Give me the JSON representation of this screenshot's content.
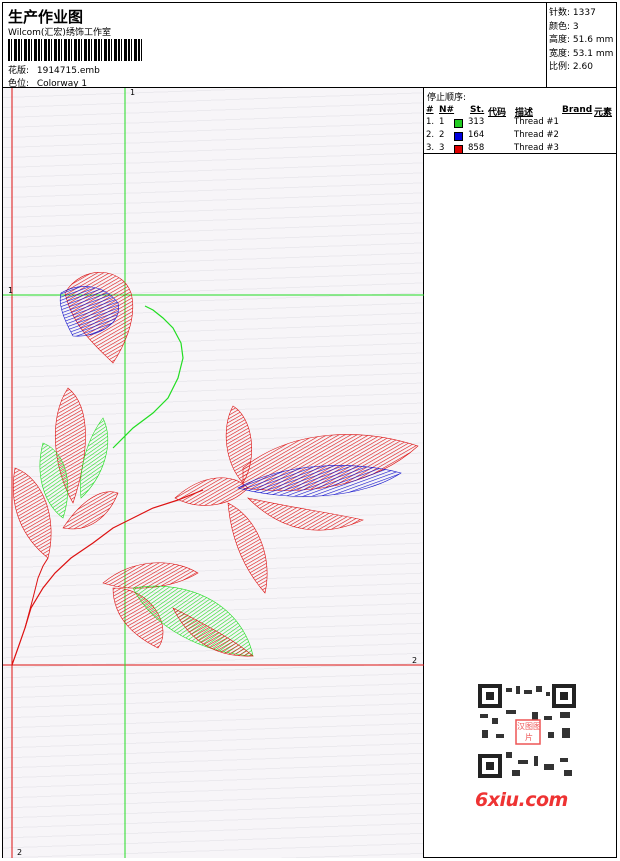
{
  "header": {
    "title": "生产作业图",
    "company": "Wilcom(汇宏)绣饰工作室",
    "design_label": "花版:",
    "design_value": "1914715.emb",
    "colorway_label": "色位:",
    "colorway_value": "Colorway 1"
  },
  "stats": [
    {
      "label": "针数:",
      "value": "1337"
    },
    {
      "label": "颜色:",
      "value": "3"
    },
    {
      "label": "高度:",
      "value": "51.6 mm"
    },
    {
      "label": "宽度:",
      "value": "53.1 mm"
    },
    {
      "label": "比例:",
      "value": "2.60"
    }
  ],
  "stop_sequence": {
    "title": "停止顺序:",
    "headers": {
      "num": "#",
      "no": "N#",
      "st": "St.",
      "code": "代码",
      "desc": "描述",
      "brand": "Brand",
      "element": "元素"
    },
    "rows": [
      {
        "num": "1.",
        "no": "1",
        "color": "#22cc22",
        "st": "313",
        "desc": "Thread #1"
      },
      {
        "num": "2.",
        "no": "2",
        "color": "#0000dd",
        "st": "164",
        "desc": "Thread #2"
      },
      {
        "num": "3.",
        "no": "3",
        "color": "#dd0000",
        "st": "858",
        "desc": "Thread #3"
      }
    ]
  },
  "axis_labels": {
    "top": "1",
    "left_guide": "1",
    "right_guide": "2",
    "bottom": "2"
  },
  "watermark": {
    "brand": "6xiu.com",
    "stamp": "汉图图片"
  },
  "colors": {
    "green": "#22dd22",
    "blue": "#1111cc",
    "red": "#dd1111"
  }
}
